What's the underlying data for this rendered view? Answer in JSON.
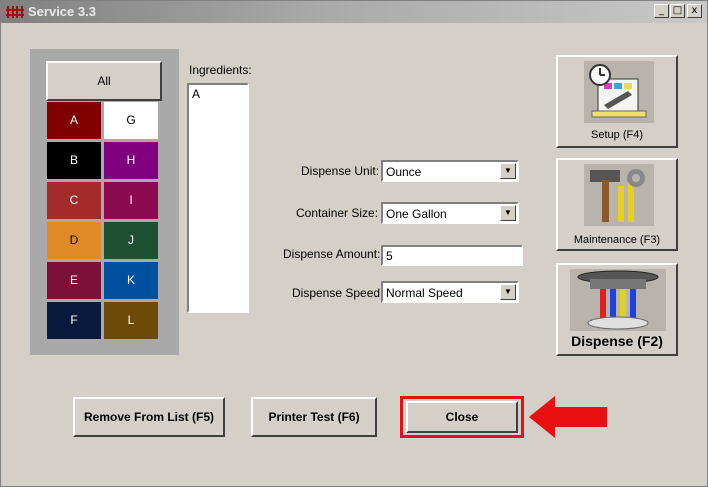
{
  "window": {
    "title": "Service 3.3",
    "controls": [
      "_",
      "□",
      "x"
    ]
  },
  "colors": {
    "all_label": "All",
    "swatches": [
      {
        "label": "A",
        "bg": "#800000",
        "fg": "#ffffff"
      },
      {
        "label": "G",
        "bg": "#ffffff",
        "fg": "#000000"
      },
      {
        "label": "B",
        "bg": "#000000",
        "fg": "#ffffff"
      },
      {
        "label": "H",
        "bg": "#800080",
        "fg": "#ffffff"
      },
      {
        "label": "C",
        "bg": "#a52a2a",
        "fg": "#ffffff"
      },
      {
        "label": "I",
        "bg": "#8b0a50",
        "fg": "#ffffff"
      },
      {
        "label": "D",
        "bg": "#e08a28",
        "fg": "#000000"
      },
      {
        "label": "J",
        "bg": "#1e5032",
        "fg": "#ffffff"
      },
      {
        "label": "E",
        "bg": "#7a1038",
        "fg": "#ffffff"
      },
      {
        "label": "K",
        "bg": "#0050a0",
        "fg": "#ffffff"
      },
      {
        "label": "F",
        "bg": "#0a1a3c",
        "fg": "#ffffff"
      },
      {
        "label": "L",
        "bg": "#6e4a08",
        "fg": "#ffffff"
      }
    ]
  },
  "ingredients": {
    "label": "Ingredients:",
    "items": [
      "A"
    ]
  },
  "form": {
    "dispense_unit_label": "Dispense Unit:",
    "dispense_unit_value": "Ounce",
    "container_size_label": "Container Size:",
    "container_size_value": "One Gallon",
    "dispense_amount_label": "Dispense Amount:",
    "dispense_amount_value": "5",
    "dispense_speed_label": "Dispense Speed",
    "dispense_speed_value": "Normal Speed"
  },
  "side_buttons": {
    "setup": "Setup (F4)",
    "maintenance": "Maintenance (F3)",
    "dispense": "Dispense (F2)"
  },
  "bottom_buttons": {
    "remove": "Remove From List (F5)",
    "printer_test": "Printer Test (F6)",
    "close": "Close"
  },
  "annotation": {
    "highlight_color": "#e81010"
  }
}
